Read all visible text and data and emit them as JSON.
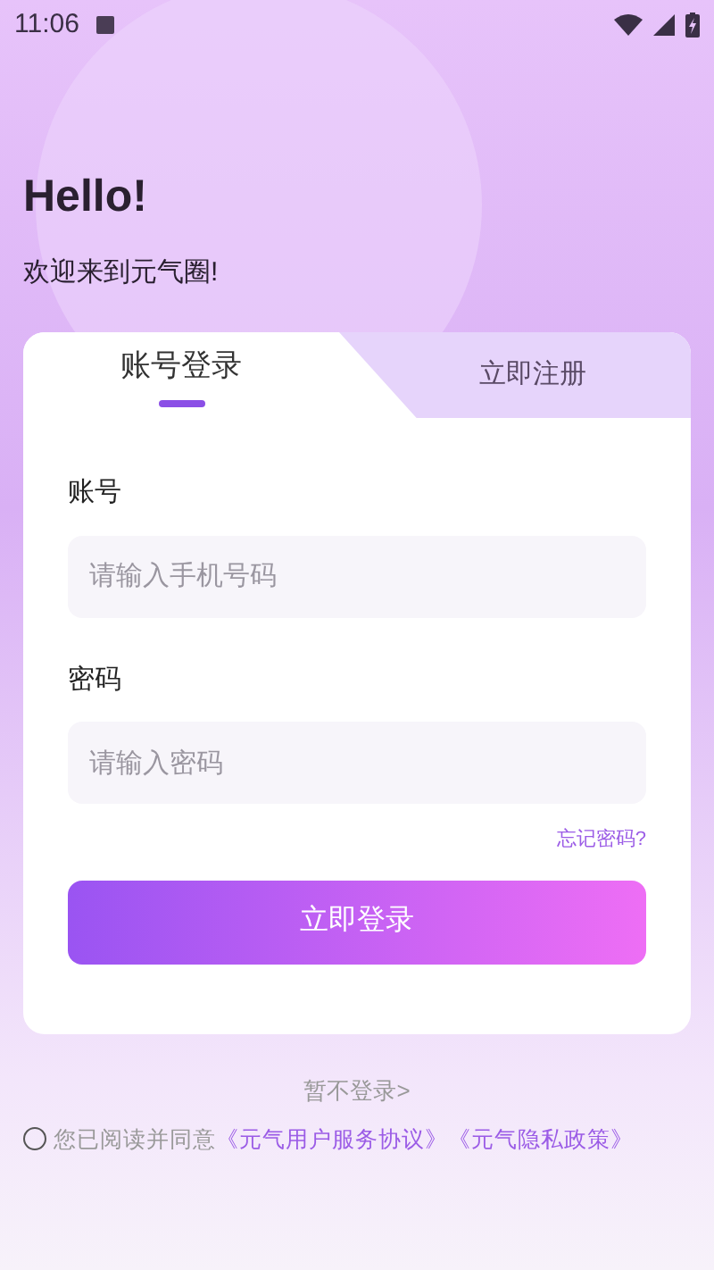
{
  "status_bar": {
    "time": "11:06"
  },
  "greeting": {
    "title": "Hello!",
    "subtitle": "欢迎来到元气圈!"
  },
  "tabs": [
    {
      "label": "账号登录",
      "selected": true
    },
    {
      "label": "立即注册",
      "selected": false
    }
  ],
  "fields": [
    {
      "label": "账号",
      "placeholder": "请输入手机号码"
    },
    {
      "label": "密码",
      "placeholder": "请输入密码"
    }
  ],
  "forgot_link": "忘记密码?",
  "login_button": "立即登录",
  "skip_link": "暂不登录>",
  "agreement": {
    "checked": false,
    "text": "您已阅读并同意",
    "links": [
      "《元气用户服务协议》",
      "《元气隐私政策》"
    ]
  }
}
